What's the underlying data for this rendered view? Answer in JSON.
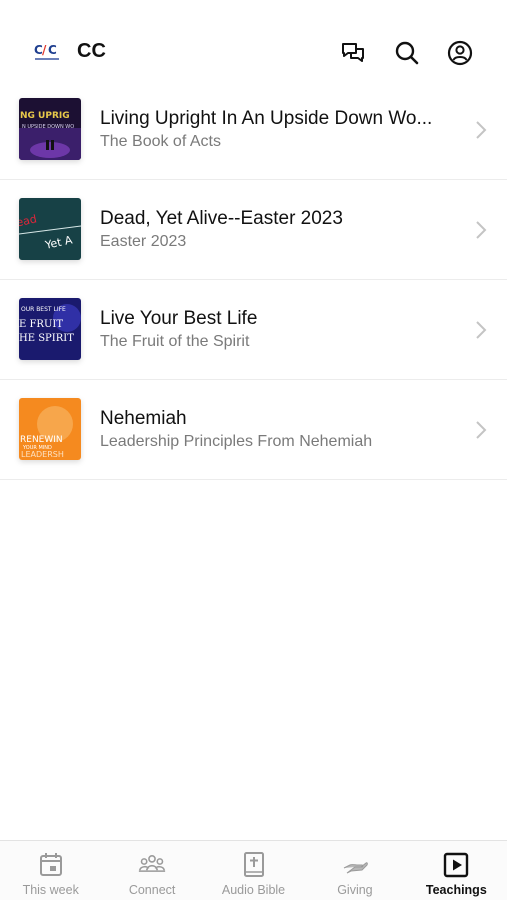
{
  "header": {
    "org_name": "CC",
    "icons": [
      "logo",
      "chat-icon",
      "search-icon",
      "account-icon"
    ]
  },
  "teachings": [
    {
      "title": "Living Upright In An Upside Down Wo...",
      "subtitle": "The Book of Acts",
      "thumb_text": "NG UPRIG",
      "thumb_colors": [
        "#1c1033",
        "#7a3db8",
        "#e8c84a"
      ]
    },
    {
      "title": "Dead, Yet Alive--Easter 2023",
      "subtitle": "Easter 2023",
      "thumb_text": "Yet A",
      "thumb_colors": [
        "#0b2a2e",
        "#2f6d73",
        "#e0263a"
      ]
    },
    {
      "title": "Live Your Best Life",
      "subtitle": "The Fruit of the Spirit",
      "thumb_text": "E FRUIT",
      "thumb_colors": [
        "#1a1a6e",
        "#3b3bbd",
        "#ffffff"
      ]
    },
    {
      "title": "Nehemiah",
      "subtitle": "Leadership Principles From Nehemiah",
      "thumb_text": "RENEWIN",
      "thumb_colors": [
        "#f58a1f",
        "#f7a64b",
        "#ffffff"
      ]
    }
  ],
  "tabs": [
    {
      "label": "This week",
      "icon": "calendar-icon",
      "active": false
    },
    {
      "label": "Connect",
      "icon": "people-icon",
      "active": false
    },
    {
      "label": "Audio Bible",
      "icon": "bible-icon",
      "active": false
    },
    {
      "label": "Giving",
      "icon": "giving-hand-icon",
      "active": false
    },
    {
      "label": "Teachings",
      "icon": "play-icon",
      "active": true
    }
  ],
  "colors": {
    "text_primary": "#111111",
    "text_secondary": "#7a7a7a",
    "tab_inactive": "#9a9a9a"
  }
}
